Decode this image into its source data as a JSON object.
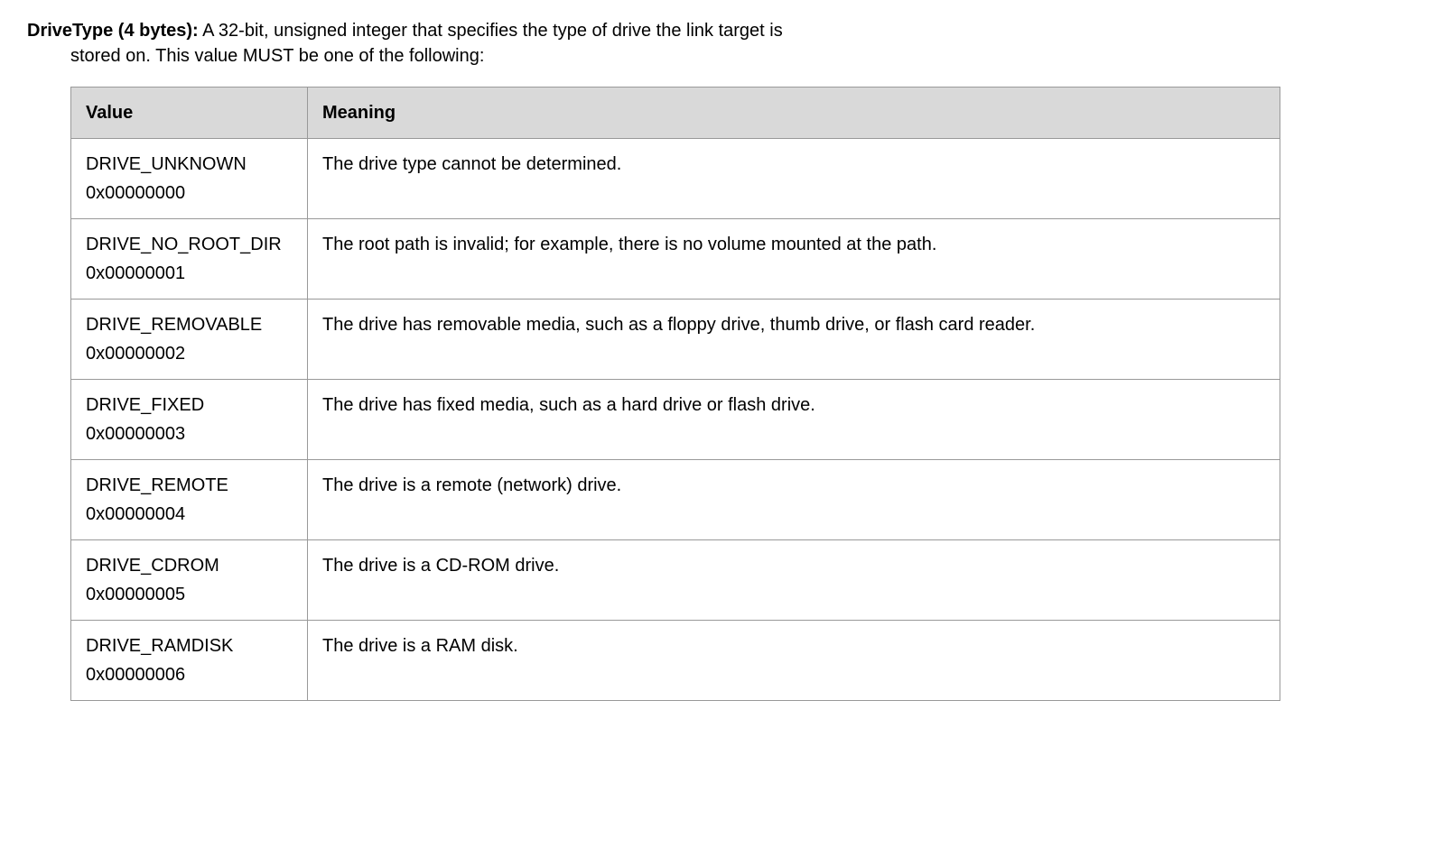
{
  "field": {
    "name": "DriveType (4 bytes):",
    "description_line1": " A 32-bit, unsigned integer that specifies the type of drive the link target is",
    "description_line2": "stored on. This value MUST be one of the following:"
  },
  "table": {
    "headers": {
      "value": "Value",
      "meaning": "Meaning"
    },
    "rows": [
      {
        "name": "DRIVE_UNKNOWN",
        "hex": "0x00000000",
        "meaning": "The drive type cannot be determined."
      },
      {
        "name": "DRIVE_NO_ROOT_DIR",
        "hex": "0x00000001",
        "meaning": "The root path is invalid; for example, there is no volume mounted at the path."
      },
      {
        "name": "DRIVE_REMOVABLE",
        "hex": "0x00000002",
        "meaning": "The drive has removable media, such as a floppy drive, thumb drive, or flash card reader."
      },
      {
        "name": "DRIVE_FIXED",
        "hex": "0x00000003",
        "meaning": "The drive has fixed media, such as a hard drive or flash drive."
      },
      {
        "name": "DRIVE_REMOTE",
        "hex": "0x00000004",
        "meaning": "The drive is a remote (network) drive."
      },
      {
        "name": "DRIVE_CDROM",
        "hex": "0x00000005",
        "meaning": "The drive is a CD-ROM drive."
      },
      {
        "name": "DRIVE_RAMDISK",
        "hex": "0x00000006",
        "meaning": "The drive is a RAM disk."
      }
    ]
  }
}
